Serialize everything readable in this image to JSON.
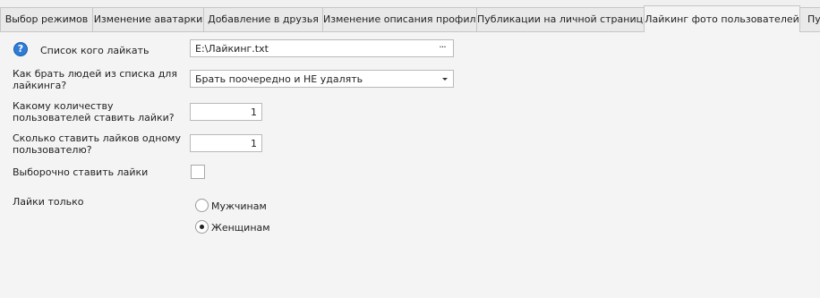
{
  "tabs": [
    {
      "label": "Выбор режимов"
    },
    {
      "label": "Изменение аватарки"
    },
    {
      "label": "Добавление в друзья"
    },
    {
      "label": "Изменение описания профиля"
    },
    {
      "label": "Публикации на личной странице"
    },
    {
      "label": "Лайкинг фото пользователей",
      "active": true
    },
    {
      "label": "Пу"
    }
  ],
  "form": {
    "list_label": "Список кого лайкать",
    "list_value": "E:\\Лайкинг.txt",
    "list_button": "···",
    "mode_label": "Как брать людей из списка для лайкинга?",
    "mode_value": "Брать поочередно и НЕ удалять",
    "users_count_label": "Какому количеству пользователей ставить лайки?",
    "users_count_value": "1",
    "likes_per_user_label": "Сколько ставить лайков одному пользователю?",
    "likes_per_user_value": "1",
    "selective_label": "Выборочно ставить лайки",
    "selective_checked": false,
    "gender_label": "Лайки только",
    "gender_options": [
      {
        "label": "Мужчинам",
        "selected": false
      },
      {
        "label": "Женщинам",
        "selected": true
      }
    ]
  },
  "icons": {
    "help": "help-icon"
  },
  "colors": {
    "help_icon": "#2f7bd6",
    "background": "#f0f0f0"
  }
}
